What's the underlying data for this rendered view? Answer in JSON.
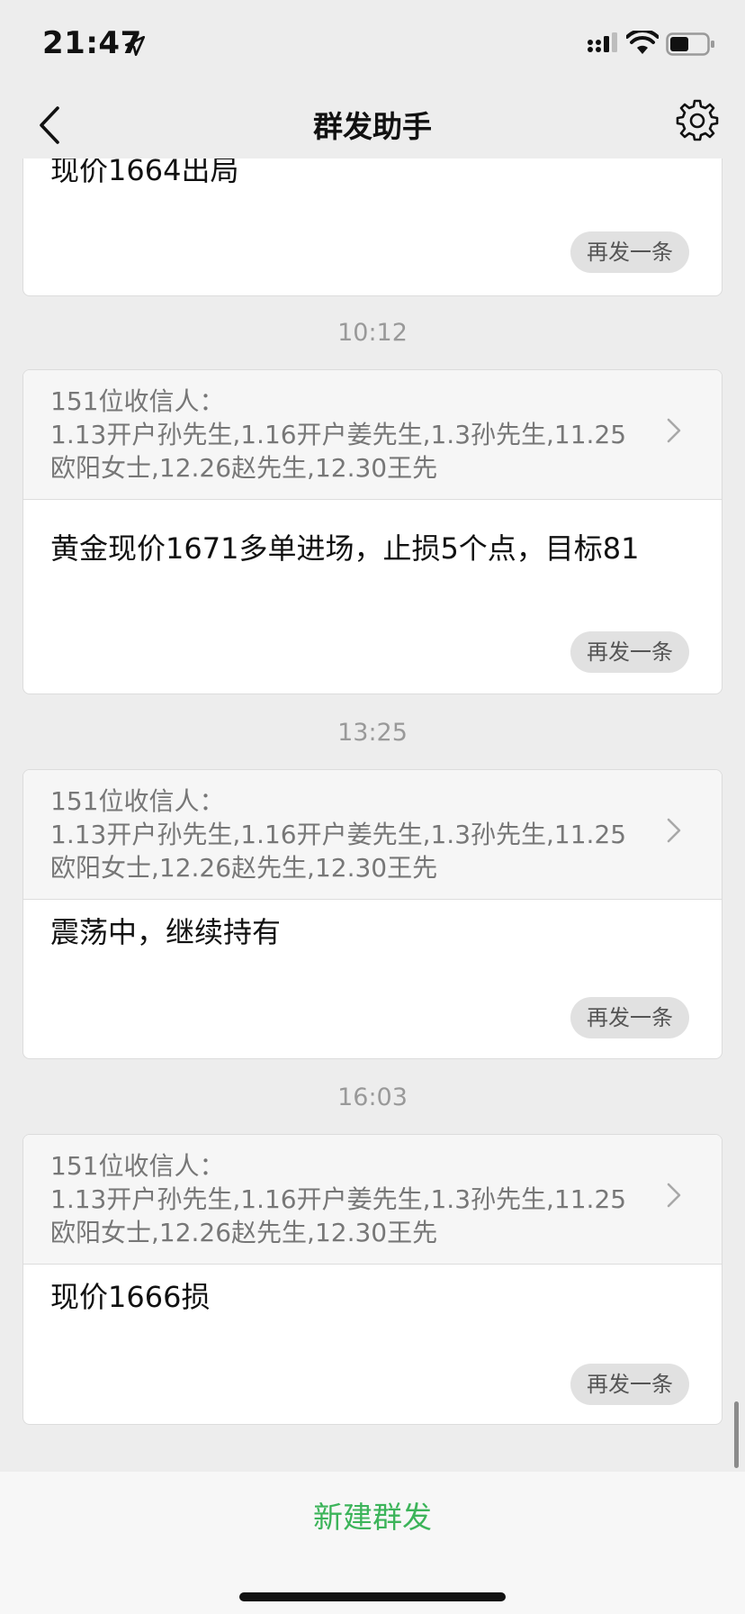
{
  "status_bar": {
    "time": "21:47"
  },
  "nav": {
    "title": "群发助手"
  },
  "cards": [
    {
      "message": "现价1664出局",
      "resend_label": "再发一条"
    },
    {
      "timestamp": "10:12",
      "recipients_count": "151位收信人：",
      "recipients_names": "1.13开户孙先生,1.16开户姜先生,1.3孙先生,11.25 欧阳女士,12.26赵先生,12.30王先",
      "message": "黄金现价1671多单进场，止损5个点，目标81",
      "resend_label": "再发一条"
    },
    {
      "timestamp": "13:25",
      "recipients_count": "151位收信人：",
      "recipients_names": "1.13开户孙先生,1.16开户姜先生,1.3孙先生,11.25 欧阳女士,12.26赵先生,12.30王先",
      "message": "震荡中，继续持有",
      "resend_label": "再发一条"
    },
    {
      "timestamp": "16:03",
      "recipients_count": "151位收信人：",
      "recipients_names": "1.13开户孙先生,1.16开户姜先生,1.3孙先生,11.25 欧阳女士,12.26赵先生,12.30王先",
      "message": "现价1666损",
      "resend_label": "再发一条"
    }
  ],
  "bottom": {
    "new_broadcast_label": "新建群发"
  },
  "colors": {
    "background": "#ededed",
    "accent_green": "#3cb45a"
  }
}
